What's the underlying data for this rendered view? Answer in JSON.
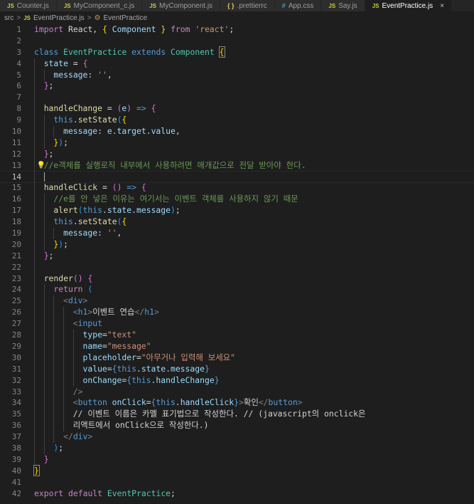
{
  "tabs": [
    {
      "icon": "js",
      "label": "Counter.js",
      "active": false
    },
    {
      "icon": "js",
      "label": "MyComponent_c.js",
      "active": false
    },
    {
      "icon": "js",
      "label": "MyComponent.js",
      "active": false
    },
    {
      "icon": "rc",
      "label": ".prettierrc",
      "active": false
    },
    {
      "icon": "css",
      "label": "App.css",
      "active": false
    },
    {
      "icon": "js",
      "label": "Say.js",
      "active": false
    },
    {
      "icon": "js",
      "label": "EventPractice.js",
      "active": true
    }
  ],
  "icon_text": {
    "js": "JS",
    "css": "#",
    "rc": "{ }",
    "close": "×"
  },
  "breadcrumb": {
    "folder": "src",
    "file": "EventPractice.js",
    "symbol": "EventPractice",
    "separator": ">"
  },
  "current_line": 14,
  "lines": [
    {
      "n": 1,
      "indent": 0,
      "tokens": [
        [
          "kw",
          "import"
        ],
        [
          "df",
          " React, "
        ],
        [
          "b1",
          "{"
        ],
        [
          "df",
          " "
        ],
        [
          "vr",
          "Component"
        ],
        [
          "df",
          " "
        ],
        [
          "b1",
          "}"
        ],
        [
          "df",
          " "
        ],
        [
          "kw",
          "from"
        ],
        [
          "df",
          " "
        ],
        [
          "str",
          "'react'"
        ],
        [
          "df",
          ";"
        ]
      ]
    },
    {
      "n": 2,
      "indent": 0,
      "tokens": []
    },
    {
      "n": 3,
      "indent": 0,
      "tokens": [
        [
          "st",
          "class"
        ],
        [
          "df",
          " "
        ],
        [
          "ty",
          "EventPractice"
        ],
        [
          "df",
          " "
        ],
        [
          "st",
          "extends"
        ],
        [
          "df",
          " "
        ],
        [
          "ty",
          "Component"
        ],
        [
          "df",
          " "
        ],
        [
          "bm",
          "{"
        ]
      ]
    },
    {
      "n": 4,
      "indent": 1,
      "tokens": [
        [
          "vr",
          "state"
        ],
        [
          "df",
          " = "
        ],
        [
          "b2",
          "{"
        ]
      ]
    },
    {
      "n": 5,
      "indent": 2,
      "tokens": [
        [
          "vr",
          "message"
        ],
        [
          "df",
          ": "
        ],
        [
          "str",
          "''"
        ],
        [
          "df",
          ","
        ]
      ]
    },
    {
      "n": 6,
      "indent": 1,
      "tokens": [
        [
          "b2",
          "}"
        ],
        [
          "df",
          ";"
        ]
      ]
    },
    {
      "n": 7,
      "indent": 1,
      "tokens": []
    },
    {
      "n": 8,
      "indent": 1,
      "tokens": [
        [
          "fn",
          "handleChange"
        ],
        [
          "df",
          " = "
        ],
        [
          "b2",
          "("
        ],
        [
          "vr",
          "e"
        ],
        [
          "b2",
          ")"
        ],
        [
          "df",
          " "
        ],
        [
          "st",
          "=>"
        ],
        [
          "df",
          " "
        ],
        [
          "b2",
          "{"
        ]
      ]
    },
    {
      "n": 9,
      "indent": 2,
      "tokens": [
        [
          "st",
          "this"
        ],
        [
          "df",
          "."
        ],
        [
          "fn",
          "setState"
        ],
        [
          "b3",
          "("
        ],
        [
          "b1",
          "{"
        ]
      ]
    },
    {
      "n": 10,
      "indent": 3,
      "tokens": [
        [
          "vr",
          "message"
        ],
        [
          "df",
          ": "
        ],
        [
          "vr",
          "e"
        ],
        [
          "df",
          "."
        ],
        [
          "vr",
          "target"
        ],
        [
          "df",
          "."
        ],
        [
          "vr",
          "value"
        ],
        [
          "df",
          ","
        ]
      ]
    },
    {
      "n": 11,
      "indent": 2,
      "tokens": [
        [
          "b1",
          "}"
        ],
        [
          "b3",
          ")"
        ],
        [
          "df",
          ";"
        ]
      ]
    },
    {
      "n": 12,
      "indent": 1,
      "tokens": [
        [
          "b2",
          "}"
        ],
        [
          "df",
          ";"
        ]
      ]
    },
    {
      "n": 13,
      "indent": 1,
      "bulb": true,
      "tokens": [
        [
          "cm",
          "//e객체를 실행로직 내부에서 사용하려면 매개값으로 전달 받아야 한다."
        ]
      ]
    },
    {
      "n": 14,
      "indent": 1,
      "caret": true,
      "tokens": []
    },
    {
      "n": 15,
      "indent": 1,
      "tokens": [
        [
          "fn",
          "handleClick"
        ],
        [
          "df",
          " = "
        ],
        [
          "b2",
          "("
        ],
        [
          "b2",
          ")"
        ],
        [
          "df",
          " "
        ],
        [
          "st",
          "=>"
        ],
        [
          "df",
          " "
        ],
        [
          "b2",
          "{"
        ]
      ]
    },
    {
      "n": 16,
      "indent": 2,
      "tokens": [
        [
          "cm",
          "//e를 안 넣은 이유는 여기서는 이벤트 객체를 사용하지 않기 때문"
        ]
      ]
    },
    {
      "n": 17,
      "indent": 2,
      "tokens": [
        [
          "fn",
          "alert"
        ],
        [
          "b3",
          "("
        ],
        [
          "st",
          "this"
        ],
        [
          "df",
          "."
        ],
        [
          "vr",
          "state"
        ],
        [
          "df",
          "."
        ],
        [
          "vr",
          "message"
        ],
        [
          "b3",
          ")"
        ],
        [
          "df",
          ";"
        ]
      ]
    },
    {
      "n": 18,
      "indent": 2,
      "tokens": [
        [
          "st",
          "this"
        ],
        [
          "df",
          "."
        ],
        [
          "fn",
          "setState"
        ],
        [
          "b3",
          "("
        ],
        [
          "b1",
          "{"
        ]
      ]
    },
    {
      "n": 19,
      "indent": 3,
      "tokens": [
        [
          "vr",
          "message"
        ],
        [
          "df",
          ": "
        ],
        [
          "str",
          "''"
        ],
        [
          "df",
          ","
        ]
      ]
    },
    {
      "n": 20,
      "indent": 2,
      "tokens": [
        [
          "b1",
          "}"
        ],
        [
          "b3",
          ")"
        ],
        [
          "df",
          ";"
        ]
      ]
    },
    {
      "n": 21,
      "indent": 1,
      "tokens": [
        [
          "b2",
          "}"
        ],
        [
          "df",
          ";"
        ]
      ]
    },
    {
      "n": 22,
      "indent": 1,
      "tokens": []
    },
    {
      "n": 23,
      "indent": 1,
      "tokens": [
        [
          "fn",
          "render"
        ],
        [
          "b2",
          "("
        ],
        [
          "b2",
          ")"
        ],
        [
          "df",
          " "
        ],
        [
          "b2",
          "{"
        ]
      ]
    },
    {
      "n": 24,
      "indent": 2,
      "tokens": [
        [
          "kw",
          "return"
        ],
        [
          "df",
          " "
        ],
        [
          "b3",
          "("
        ]
      ]
    },
    {
      "n": 25,
      "indent": 3,
      "tokens": [
        [
          "ang",
          "<"
        ],
        [
          "tag",
          "div"
        ],
        [
          "ang",
          ">"
        ]
      ]
    },
    {
      "n": 26,
      "indent": 4,
      "tokens": [
        [
          "ang",
          "<"
        ],
        [
          "tag",
          "h1"
        ],
        [
          "ang",
          ">"
        ],
        [
          "df",
          "이벤트 연습"
        ],
        [
          "ang",
          "</"
        ],
        [
          "tag",
          "h1"
        ],
        [
          "ang",
          ">"
        ]
      ]
    },
    {
      "n": 27,
      "indent": 4,
      "tokens": [
        [
          "ang",
          "<"
        ],
        [
          "tag",
          "input"
        ]
      ]
    },
    {
      "n": 28,
      "indent": 5,
      "tokens": [
        [
          "vr",
          "type"
        ],
        [
          "df",
          "="
        ],
        [
          "str",
          "\"text\""
        ]
      ]
    },
    {
      "n": 29,
      "indent": 5,
      "tokens": [
        [
          "vr",
          "name"
        ],
        [
          "df",
          "="
        ],
        [
          "str",
          "\"message\""
        ]
      ]
    },
    {
      "n": 30,
      "indent": 5,
      "tokens": [
        [
          "vr",
          "placeholder"
        ],
        [
          "df",
          "="
        ],
        [
          "str",
          "\"아무거나 입력해 보세요\""
        ]
      ]
    },
    {
      "n": 31,
      "indent": 5,
      "tokens": [
        [
          "vr",
          "value"
        ],
        [
          "df",
          "="
        ],
        [
          "st",
          "{"
        ],
        [
          "st",
          "this"
        ],
        [
          "df",
          "."
        ],
        [
          "vr",
          "state"
        ],
        [
          "df",
          "."
        ],
        [
          "vr",
          "message"
        ],
        [
          "st",
          "}"
        ]
      ]
    },
    {
      "n": 32,
      "indent": 5,
      "tokens": [
        [
          "vr",
          "onChange"
        ],
        [
          "df",
          "="
        ],
        [
          "st",
          "{"
        ],
        [
          "st",
          "this"
        ],
        [
          "df",
          "."
        ],
        [
          "vr",
          "handleChange"
        ],
        [
          "st",
          "}"
        ]
      ]
    },
    {
      "n": 33,
      "indent": 4,
      "tokens": [
        [
          "ang",
          "/>"
        ]
      ]
    },
    {
      "n": 34,
      "indent": 4,
      "tokens": [
        [
          "ang",
          "<"
        ],
        [
          "tag",
          "button"
        ],
        [
          "df",
          " "
        ],
        [
          "vr",
          "onClick"
        ],
        [
          "df",
          "="
        ],
        [
          "st",
          "{"
        ],
        [
          "st",
          "this"
        ],
        [
          "df",
          "."
        ],
        [
          "vr",
          "handleClick"
        ],
        [
          "st",
          "}"
        ],
        [
          "ang",
          ">"
        ],
        [
          "df",
          "확인"
        ],
        [
          "ang",
          "</"
        ],
        [
          "tag",
          "button"
        ],
        [
          "ang",
          ">"
        ]
      ]
    },
    {
      "n": 35,
      "indent": 4,
      "tokens": [
        [
          "df",
          "// 이벤트 이름은 카멜 표기법으로 작성한다. // (javascript의 onclick은"
        ]
      ]
    },
    {
      "n": 36,
      "indent": 4,
      "tokens": [
        [
          "df",
          "리액트에서 onClick으로 작성한다.)"
        ]
      ]
    },
    {
      "n": 37,
      "indent": 3,
      "tokens": [
        [
          "ang",
          "</"
        ],
        [
          "tag",
          "div"
        ],
        [
          "ang",
          ">"
        ]
      ]
    },
    {
      "n": 38,
      "indent": 2,
      "tokens": [
        [
          "b3",
          ")"
        ],
        [
          "df",
          ";"
        ]
      ]
    },
    {
      "n": 39,
      "indent": 1,
      "tokens": [
        [
          "b2",
          "}"
        ]
      ]
    },
    {
      "n": 40,
      "indent": 0,
      "tokens": [
        [
          "bm",
          "}"
        ]
      ]
    },
    {
      "n": 41,
      "indent": 0,
      "tokens": []
    },
    {
      "n": 42,
      "indent": 0,
      "tokens": [
        [
          "kw",
          "export"
        ],
        [
          "df",
          " "
        ],
        [
          "kw",
          "default"
        ],
        [
          "df",
          " "
        ],
        [
          "ty",
          "EventPractice"
        ],
        [
          "df",
          ";"
        ]
      ]
    }
  ]
}
